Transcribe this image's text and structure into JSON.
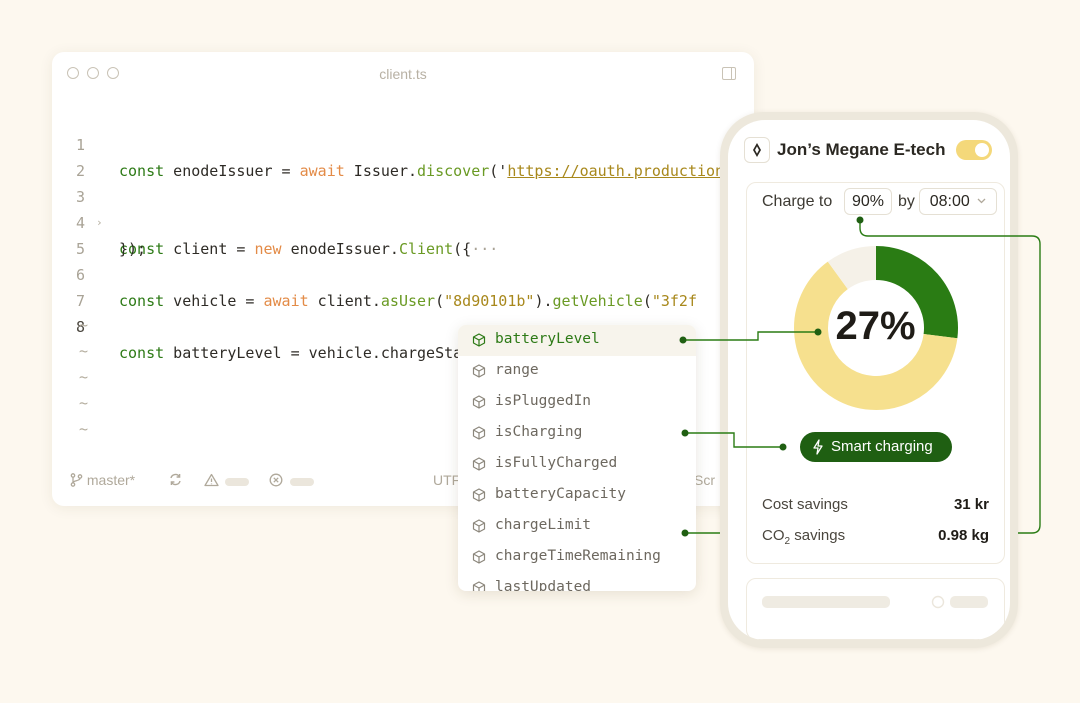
{
  "editor": {
    "filename": "client.ts",
    "lines": [
      {
        "num": "1"
      },
      {
        "num": "2"
      },
      {
        "num": "3",
        "fold": "›"
      },
      {
        "num": "4"
      },
      {
        "num": "5"
      },
      {
        "num": "6"
      },
      {
        "num": "7"
      },
      {
        "num": "8"
      }
    ],
    "code": {
      "l1_kw": "const",
      "l1_var": " enodeIssuer = ",
      "l1_await": "await",
      "l1_cls": " Issuer.",
      "l1_fn": "discover",
      "l1_p": "('",
      "l1_url": "https://oauth.production",
      "l3_kw": "const",
      "l3_var": " client = ",
      "l3_new": "new",
      "l3_cls": " enodeIssuer.",
      "l3_fn": "Client",
      "l3_p": "({",
      "l3_ell": "···",
      "l4": "});",
      "l6_kw": "const",
      "l6_var": " vehicle = ",
      "l6_await": "await",
      "l6_cls": " client.",
      "l6_fn1": "asUser",
      "l6_p1": "(",
      "l6_s1": "\"8d90101b\"",
      "l6_p2": ").",
      "l6_fn2": "getVehicle",
      "l6_p3": "(",
      "l6_s2": "\"3f2f",
      "l8_kw": "const",
      "l8_rest": " batteryLevel = vehicle.chargeState."
    },
    "tilde": "~",
    "status": {
      "branch": "master*",
      "encoding": "UTF",
      "mode": "Scr"
    }
  },
  "autocomplete": {
    "items": [
      "batteryLevel",
      "range",
      "isPluggedIn",
      "isCharging",
      "isFullyCharged",
      "batteryCapacity",
      "chargeLimit",
      "chargeTimeRemaining",
      "lastUpdated"
    ],
    "selected_index": 0
  },
  "phone": {
    "car_name": "Jon’s Megane E-tech",
    "toggle_on": true,
    "charge_to_label": "Charge to",
    "charge_target": "90%",
    "by_label": "by",
    "time": "08:00",
    "charge_percent": "27%",
    "charge_level": 0.27,
    "target_level": 0.9,
    "smart_charging": "Smart charging",
    "cost_savings_label": "Cost savings",
    "cost_savings_value": "31 kr",
    "co2_label_prefix": "CO",
    "co2_label_sub": "2",
    "co2_label_suffix": " savings",
    "co2_value": "0.98 kg"
  },
  "colors": {
    "green_dark": "#1f5f12",
    "green": "#2a7c14",
    "yellow": "#f6e08e",
    "yellow_toggle": "#f4d87a",
    "background": "#fdf8ef"
  }
}
